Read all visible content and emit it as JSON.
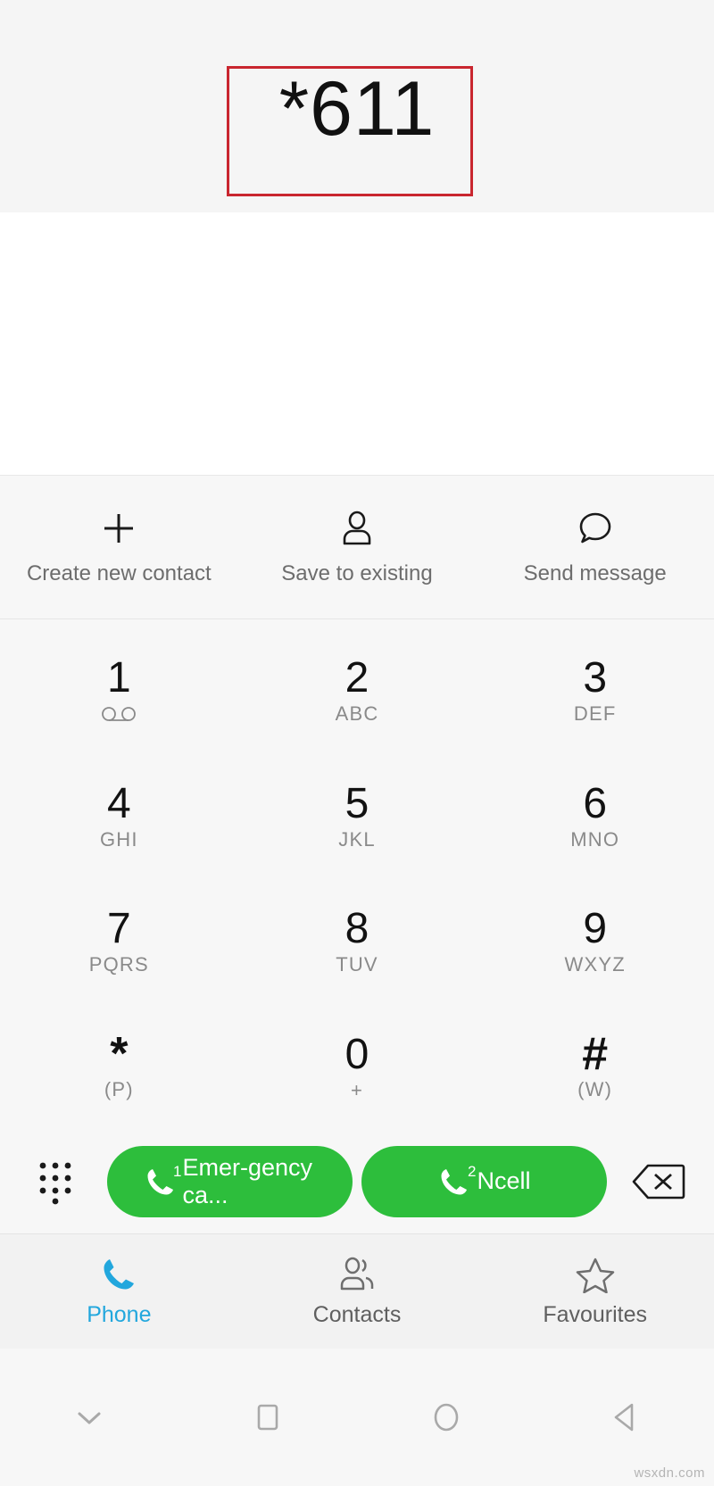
{
  "display": {
    "dialed_number": "*611",
    "highlight_color": "#c9262f"
  },
  "quick_actions": [
    {
      "icon": "plus-icon",
      "label": "Create new contact"
    },
    {
      "icon": "person-icon",
      "label": "Save to existing"
    },
    {
      "icon": "message-bubble-icon",
      "label": "Send message"
    }
  ],
  "keypad": {
    "rows": [
      [
        {
          "digit": "1",
          "sub": "",
          "icon": "voicemail-icon"
        },
        {
          "digit": "2",
          "sub": "ABC",
          "icon": ""
        },
        {
          "digit": "3",
          "sub": "DEF",
          "icon": ""
        }
      ],
      [
        {
          "digit": "4",
          "sub": "GHI",
          "icon": ""
        },
        {
          "digit": "5",
          "sub": "JKL",
          "icon": ""
        },
        {
          "digit": "6",
          "sub": "MNO",
          "icon": ""
        }
      ],
      [
        {
          "digit": "7",
          "sub": "PQRS",
          "icon": ""
        },
        {
          "digit": "8",
          "sub": "TUV",
          "icon": ""
        },
        {
          "digit": "9",
          "sub": "WXYZ",
          "icon": ""
        }
      ],
      [
        {
          "digit": "*",
          "sub": "(P)",
          "icon": ""
        },
        {
          "digit": "0",
          "sub": "+",
          "icon": ""
        },
        {
          "digit": "#",
          "sub": "(W)",
          "icon": ""
        }
      ]
    ]
  },
  "call_row": {
    "dialpad_toggle_icon": "dialpad-dots-icon",
    "backspace_icon": "backspace-icon",
    "buttons": [
      {
        "sim": "1",
        "label": "Emer-gency ca...",
        "color": "#2dbe3c"
      },
      {
        "sim": "2",
        "label": "Ncell",
        "color": "#2dbe3c"
      }
    ]
  },
  "tabbar": {
    "active_color": "#22a7dd",
    "tabs": [
      {
        "icon": "phone-handset-icon",
        "label": "Phone",
        "active": true
      },
      {
        "icon": "contacts-people-icon",
        "label": "Contacts",
        "active": false
      },
      {
        "icon": "star-icon",
        "label": "Favourites",
        "active": false
      }
    ]
  },
  "navbar": {
    "buttons": [
      {
        "icon": "chevron-down-icon"
      },
      {
        "icon": "square-recents-icon"
      },
      {
        "icon": "circle-home-icon"
      },
      {
        "icon": "triangle-back-icon"
      }
    ]
  },
  "watermark": "wsxdn.com"
}
